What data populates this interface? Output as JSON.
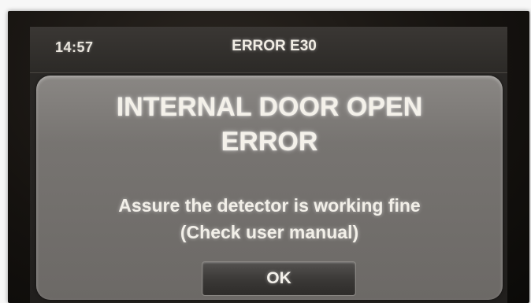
{
  "status_bar": {
    "time": "14:57",
    "title": "ERROR E30"
  },
  "dialog": {
    "title_lines": [
      "INTERNAL DOOR OPEN",
      "ERROR"
    ],
    "message_lines": [
      "Assure the detector is working fine",
      "(Check user manual)"
    ],
    "ok_label": "OK"
  }
}
